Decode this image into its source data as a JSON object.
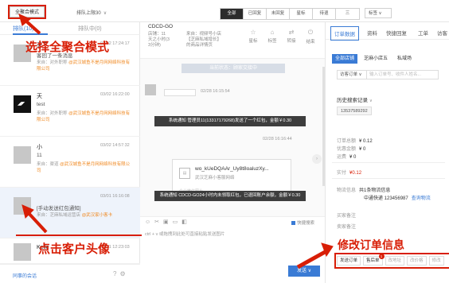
{
  "topbar": {
    "mode_button": "全聚合模式",
    "queue_select": "排队上限30",
    "filters": [
      "全部",
      "已回复",
      "未回复",
      "星标",
      "待退",
      "三"
    ],
    "label_select": "标签"
  },
  "left": {
    "tabs": [
      {
        "label": "排队(10)",
        "active": true
      },
      {
        "label": "排队中(0)",
        "active": false
      }
    ],
    "conversations": [
      {
        "name": "天下",
        "time": "03/02 17:24:17",
        "message": "客回了一条消息",
        "source_label": "来自：",
        "source_text": "对外职称",
        "shop": "@武汉城鱼不是月网网络科技有限公司",
        "avatar": "grey"
      },
      {
        "name": "天",
        "time": "03/02 16:22:00",
        "message": "test",
        "source_label": "来自：",
        "source_text": "对外职称",
        "shop": "@武汉城鱼不是月网网络科技有限公司",
        "avatar": "dark"
      },
      {
        "name": "小",
        "time": "03/02 14:57:32",
        "message": "11",
        "source_label": "来自：",
        "source_text": "渠道",
        "shop": "@武汉城鱼不是月网网络科技有限公司",
        "avatar": "grey"
      },
      {
        "name": "",
        "time": "03/01 16:16:08",
        "message": "[手动发送红包通知]",
        "source_label": "来自：",
        "source_text": "芝麻私域运营店",
        "shop": "@武汉家小客卡",
        "avatar": "grey"
      },
      {
        "name": "Kelle",
        "time": "03/01 12:23:03",
        "message": "",
        "source_label": "",
        "source_text": "",
        "shop": "",
        "avatar": "grey"
      }
    ],
    "footer_link": "同事的会话",
    "footer_icons": [
      "help-icon",
      "settings-icon"
    ]
  },
  "chat": {
    "title": "CDCD-GO",
    "meta_left": [
      "店铺：11",
      "天之小时(3",
      "3分钟)"
    ],
    "meta_right": [
      "来自：视频号小店",
      "【芝麻私域增长】",
      "的商品详情页"
    ],
    "actions": [
      {
        "icon": "star-icon",
        "label": "星标"
      },
      {
        "icon": "tag-icon",
        "label": "标签"
      },
      {
        "icon": "transfer-icon",
        "label": "转接"
      },
      {
        "icon": "power-icon",
        "label": "结束"
      }
    ],
    "status_pill": "当前状态：顾家交接中",
    "bubble_text": "",
    "bubble_time": "02/28 16:15:54",
    "system_note_1": "系统通知 管理员11(13317179268)发送了一个红包，金额￥0.30",
    "card_time": "02/28 16:16:44",
    "card_title": "wo_kUeDQAAr_Uy8t8oaluzXy...",
    "card_sub": "武汉芝麻小客服网络",
    "card_foot": "企业微信图片",
    "system_note_2": "系统通知 CDCD-GO24小时内未领取红包，已退回账户余额，金额￥0.30",
    "quick_reply": "快捷搜索",
    "input_hint": "ctrl + v 或拖拽到此处可直接粘贴发送图片",
    "send_label": "发送"
  },
  "right": {
    "tabs": [
      "订单数据",
      "资料",
      "快捷回复",
      "工单",
      "访客"
    ],
    "shop_tabs": [
      {
        "label": "全部店铺",
        "active": true
      },
      {
        "label": "芝麻小店五",
        "active": false
      },
      {
        "label": "私域场",
        "active": false
      }
    ],
    "search_select": "访客订单",
    "search_placeholder": "输入订单号、收件人姓名...",
    "history_title": "历史搜索记录",
    "history_chip": "13537589292",
    "order_total_label": "订单总额",
    "order_total": "¥ 0.12",
    "discount_label": "优惠金额",
    "discount": "¥ 0",
    "shipping_label": "运费",
    "shipping": "¥ 0",
    "paid_label": "实付",
    "paid": "¥0.12",
    "logistics_label": "物流信息",
    "logistics_count": "共1条物流信息",
    "logistics_carrier": "中通快递 123456987",
    "logistics_link": "查询物流",
    "buyer_note_label": "买家备注",
    "seller_note_label": "卖家备注",
    "bottom_actions": [
      {
        "label": "发送订单",
        "badge": "",
        "muted": false
      },
      {
        "label": "售后单",
        "badge": "1",
        "muted": false
      },
      {
        "label": "改地址",
        "badge": "",
        "muted": true
      },
      {
        "label": "改价格",
        "badge": "",
        "muted": true
      },
      {
        "label": "修改",
        "badge": "",
        "muted": true
      }
    ]
  },
  "annotations": {
    "select_mode": "选择全聚合模式",
    "click_avatar": "点击客户头像",
    "edit_order": "修改订单信息"
  },
  "colors": {
    "accent": "#3a7bd5",
    "annotation_red": "#d81e06",
    "shop_orange": "#f08a24"
  }
}
